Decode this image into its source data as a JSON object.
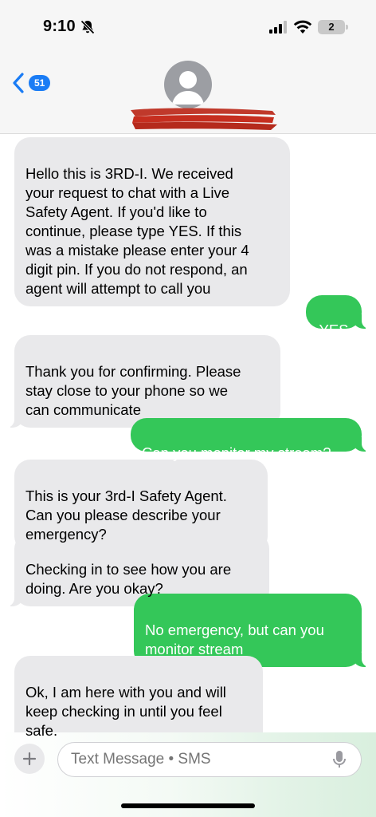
{
  "status_bar": {
    "time": "9:10",
    "battery": "2",
    "icons": [
      "bell-slash-icon",
      "cellular-signal-icon",
      "wifi-icon",
      "battery-icon"
    ]
  },
  "header": {
    "back_count": "51",
    "back_icon": "chevron-left-icon",
    "avatar_icon": "person-silhouette-icon",
    "contact_name_redacted": true
  },
  "messages": [
    {
      "direction": "incoming",
      "text": "Hello this is 3RD-I. We received\nyour request to chat with a Live\nSafety Agent. If you'd like to\ncontinue, please type YES. If this\nwas a mistake please enter your 4\ndigit pin. If you do not respond, an\nagent will attempt to call you"
    },
    {
      "direction": "outgoing",
      "text": "YES"
    },
    {
      "direction": "incoming",
      "text": "Thank you for confirming. Please\nstay close to your phone so we\ncan communicate"
    },
    {
      "direction": "outgoing",
      "text": "Can you monitor my stream?"
    },
    {
      "direction": "incoming",
      "text": "This is your 3rd-I Safety Agent.\nCan you please describe your\nemergency?"
    },
    {
      "direction": "incoming",
      "text": "Checking in to see how you are\ndoing. Are you okay?"
    },
    {
      "direction": "outgoing",
      "text": "No emergency, but can you\nmonitor stream"
    },
    {
      "direction": "incoming",
      "text": "Ok, I am here with you and will\nkeep checking in until you feel\nsafe."
    }
  ],
  "composer": {
    "placeholder": "Text Message • SMS",
    "plus_icon": "plus-icon",
    "mic_icon": "microphone-icon"
  },
  "colors": {
    "incoming_bubble": "#e9e9eb",
    "outgoing_bubble": "#34c759",
    "accent_blue": "#1a7cf5"
  }
}
